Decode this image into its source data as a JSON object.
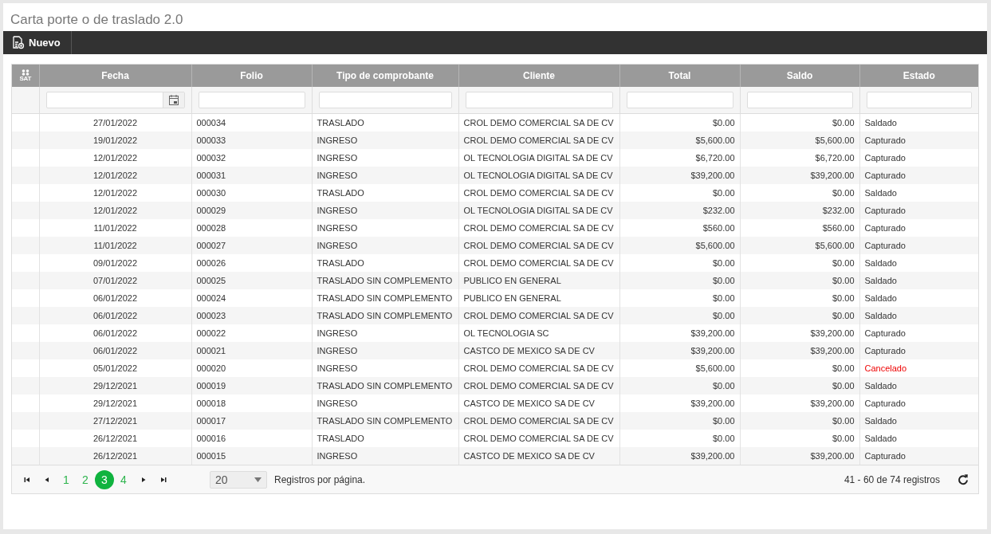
{
  "title": "Carta porte o de traslado 2.0",
  "toolbar": {
    "new_button": "Nuevo"
  },
  "table": {
    "sat_label": "SAT",
    "columns": [
      "Fecha",
      "Folio",
      "Tipo de comprobante",
      "Cliente",
      "Total",
      "Saldo",
      "Estado"
    ],
    "rows": [
      {
        "fecha": "27/01/2022",
        "folio": "000034",
        "tipo": "TRASLADO",
        "cliente": "CROL DEMO COMERCIAL SA DE CV",
        "total": "$0.00",
        "saldo": "$0.00",
        "estado": "Saldado",
        "cancelled": false
      },
      {
        "fecha": "19/01/2022",
        "folio": "000033",
        "tipo": "INGRESO",
        "cliente": "CROL DEMO COMERCIAL SA DE CV",
        "total": "$5,600.00",
        "saldo": "$5,600.00",
        "estado": "Capturado",
        "cancelled": false
      },
      {
        "fecha": "12/01/2022",
        "folio": "000032",
        "tipo": "INGRESO",
        "cliente": "OL TECNOLOGIA DIGITAL SA DE CV",
        "total": "$6,720.00",
        "saldo": "$6,720.00",
        "estado": "Capturado",
        "cancelled": false
      },
      {
        "fecha": "12/01/2022",
        "folio": "000031",
        "tipo": "INGRESO",
        "cliente": "OL TECNOLOGIA DIGITAL SA DE CV",
        "total": "$39,200.00",
        "saldo": "$39,200.00",
        "estado": "Capturado",
        "cancelled": false
      },
      {
        "fecha": "12/01/2022",
        "folio": "000030",
        "tipo": "TRASLADO",
        "cliente": "CROL DEMO COMERCIAL SA DE CV",
        "total": "$0.00",
        "saldo": "$0.00",
        "estado": "Saldado",
        "cancelled": false
      },
      {
        "fecha": "12/01/2022",
        "folio": "000029",
        "tipo": "INGRESO",
        "cliente": "OL TECNOLOGIA DIGITAL SA DE CV",
        "total": "$232.00",
        "saldo": "$232.00",
        "estado": "Capturado",
        "cancelled": false
      },
      {
        "fecha": "11/01/2022",
        "folio": "000028",
        "tipo": "INGRESO",
        "cliente": "CROL DEMO COMERCIAL SA DE CV",
        "total": "$560.00",
        "saldo": "$560.00",
        "estado": "Capturado",
        "cancelled": false
      },
      {
        "fecha": "11/01/2022",
        "folio": "000027",
        "tipo": "INGRESO",
        "cliente": "CROL DEMO COMERCIAL SA DE CV",
        "total": "$5,600.00",
        "saldo": "$5,600.00",
        "estado": "Capturado",
        "cancelled": false
      },
      {
        "fecha": "09/01/2022",
        "folio": "000026",
        "tipo": "TRASLADO",
        "cliente": "CROL DEMO COMERCIAL SA DE CV",
        "total": "$0.00",
        "saldo": "$0.00",
        "estado": "Saldado",
        "cancelled": false
      },
      {
        "fecha": "07/01/2022",
        "folio": "000025",
        "tipo": "TRASLADO SIN COMPLEMENTO",
        "cliente": "PUBLICO EN GENERAL",
        "total": "$0.00",
        "saldo": "$0.00",
        "estado": "Saldado",
        "cancelled": false
      },
      {
        "fecha": "06/01/2022",
        "folio": "000024",
        "tipo": "TRASLADO SIN COMPLEMENTO",
        "cliente": "PUBLICO EN GENERAL",
        "total": "$0.00",
        "saldo": "$0.00",
        "estado": "Saldado",
        "cancelled": false
      },
      {
        "fecha": "06/01/2022",
        "folio": "000023",
        "tipo": "TRASLADO SIN COMPLEMENTO",
        "cliente": "CROL DEMO COMERCIAL SA DE CV",
        "total": "$0.00",
        "saldo": "$0.00",
        "estado": "Saldado",
        "cancelled": false
      },
      {
        "fecha": "06/01/2022",
        "folio": "000022",
        "tipo": "INGRESO",
        "cliente": "OL TECNOLOGIA SC",
        "total": "$39,200.00",
        "saldo": "$39,200.00",
        "estado": "Capturado",
        "cancelled": false
      },
      {
        "fecha": "06/01/2022",
        "folio": "000021",
        "tipo": "INGRESO",
        "cliente": "CASTCO DE MEXICO SA DE CV",
        "total": "$39,200.00",
        "saldo": "$39,200.00",
        "estado": "Capturado",
        "cancelled": false
      },
      {
        "fecha": "05/01/2022",
        "folio": "000020",
        "tipo": "INGRESO",
        "cliente": "CROL DEMO COMERCIAL SA DE CV",
        "total": "$5,600.00",
        "saldo": "$0.00",
        "estado": "Cancelado",
        "cancelled": true
      },
      {
        "fecha": "29/12/2021",
        "folio": "000019",
        "tipo": "TRASLADO SIN COMPLEMENTO",
        "cliente": "CROL DEMO COMERCIAL SA DE CV",
        "total": "$0.00",
        "saldo": "$0.00",
        "estado": "Saldado",
        "cancelled": false
      },
      {
        "fecha": "29/12/2021",
        "folio": "000018",
        "tipo": "INGRESO",
        "cliente": "CASTCO DE MEXICO SA DE CV",
        "total": "$39,200.00",
        "saldo": "$39,200.00",
        "estado": "Capturado",
        "cancelled": false
      },
      {
        "fecha": "27/12/2021",
        "folio": "000017",
        "tipo": "TRASLADO SIN COMPLEMENTO",
        "cliente": "CROL DEMO COMERCIAL SA DE CV",
        "total": "$0.00",
        "saldo": "$0.00",
        "estado": "Saldado",
        "cancelled": false
      },
      {
        "fecha": "26/12/2021",
        "folio": "000016",
        "tipo": "TRASLADO",
        "cliente": "CROL DEMO COMERCIAL SA DE CV",
        "total": "$0.00",
        "saldo": "$0.00",
        "estado": "Saldado",
        "cancelled": false
      },
      {
        "fecha": "26/12/2021",
        "folio": "000015",
        "tipo": "INGRESO",
        "cliente": "CASTCO DE MEXICO SA DE CV",
        "total": "$39,200.00",
        "saldo": "$39,200.00",
        "estado": "Capturado",
        "cancelled": false
      }
    ]
  },
  "pager": {
    "pages": [
      {
        "label": "1",
        "selected": false
      },
      {
        "label": "2",
        "selected": false
      },
      {
        "label": "3",
        "selected": true
      },
      {
        "label": "4",
        "selected": false
      }
    ],
    "page_size": "20",
    "page_size_label": "Registros por página.",
    "summary": "41 - 60 de 74 registros"
  }
}
